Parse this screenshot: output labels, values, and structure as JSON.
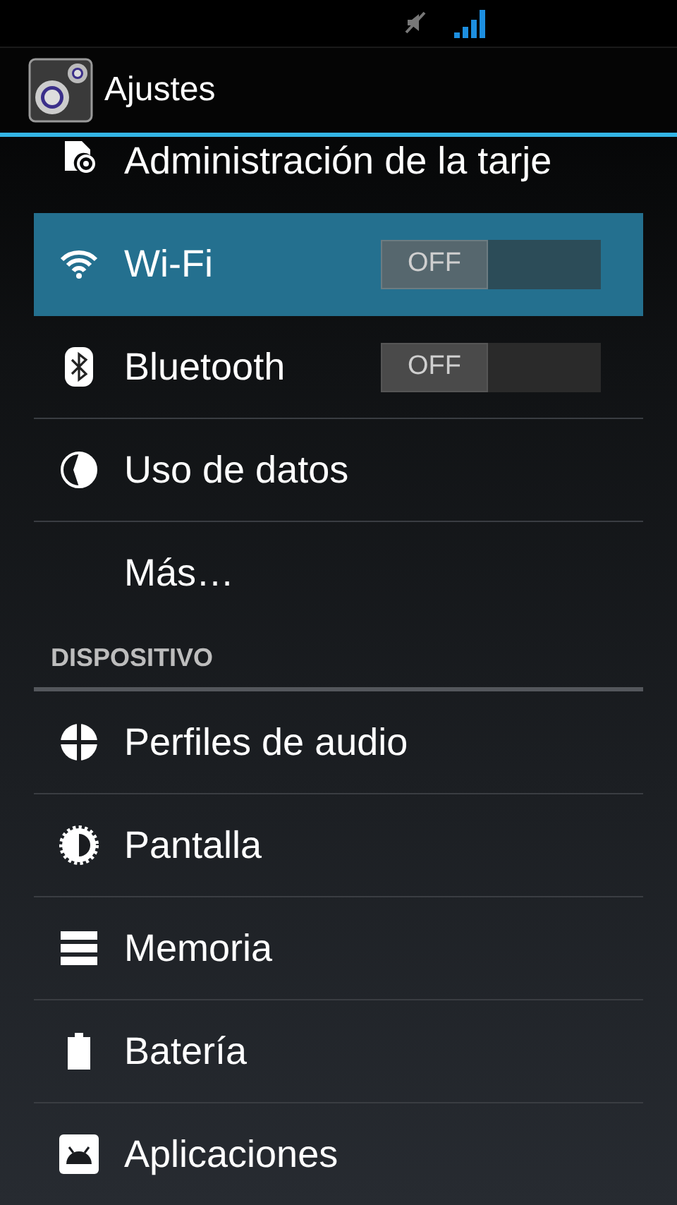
{
  "action_bar": {
    "title": "Ajustes"
  },
  "sections": [
    {
      "items": [
        {
          "label": "Administración de la tarje",
          "kind": "plain",
          "selected": false,
          "partial": true
        },
        {
          "label": "Wi-Fi",
          "kind": "toggle",
          "selected": true,
          "on": false,
          "state_label": "OFF"
        },
        {
          "label": "Bluetooth",
          "kind": "toggle",
          "selected": false,
          "on": false,
          "state_label": "OFF"
        },
        {
          "label": "Uso de datos",
          "kind": "plain",
          "selected": false
        },
        {
          "label": "Más…",
          "kind": "plain",
          "selected": false
        }
      ]
    },
    {
      "header": "DISPOSITIVO",
      "items": [
        {
          "label": "Perfiles de audio",
          "kind": "plain",
          "selected": false
        },
        {
          "label": "Pantalla",
          "kind": "plain",
          "selected": false
        },
        {
          "label": "Memoria",
          "kind": "plain",
          "selected": false
        },
        {
          "label": "Batería",
          "kind": "plain",
          "selected": false
        },
        {
          "label": "Aplicaciones",
          "kind": "plain",
          "selected": false
        }
      ]
    }
  ]
}
